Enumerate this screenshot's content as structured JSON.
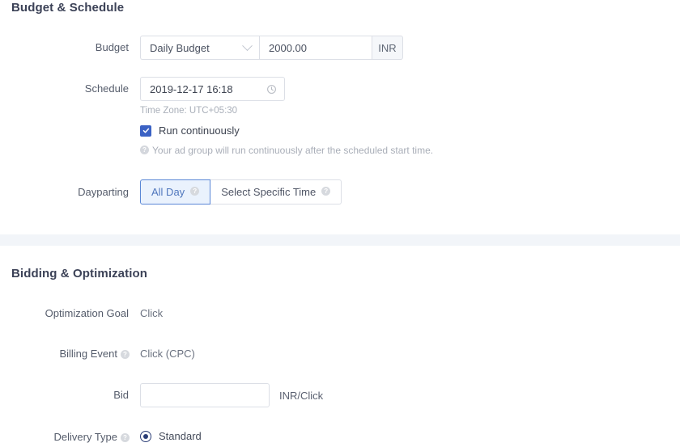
{
  "budget_schedule": {
    "title": "Budget & Schedule",
    "budget": {
      "label": "Budget",
      "type_value": "Daily Budget",
      "amount_value": "2000.00",
      "currency_suffix": "INR",
      "chevron_icon": "chevron-down-icon"
    },
    "schedule": {
      "label": "Schedule",
      "datetime_value": "2019-12-17 16:18",
      "clock_icon": "clock-icon",
      "timezone_text": "Time Zone: UTC+05:30",
      "run_continuously_label": "Run continuously",
      "run_continuously_checked": true,
      "hint_text": "Your ad group will run continuously after the scheduled start time.",
      "hint_icon": "help-circle-icon"
    },
    "dayparting": {
      "label": "Dayparting",
      "options": [
        {
          "label": "All Day",
          "selected": true,
          "help_icon": "help-circle-icon"
        },
        {
          "label": "Select Specific Time",
          "selected": false,
          "help_icon": "help-circle-icon"
        }
      ]
    }
  },
  "bidding_optimization": {
    "title": "Bidding & Optimization",
    "optimization_goal": {
      "label": "Optimization Goal",
      "value": "Click"
    },
    "billing_event": {
      "label": "Billing Event",
      "help_icon": "help-circle-icon",
      "value": "Click (CPC)"
    },
    "bid": {
      "label": "Bid",
      "value": "",
      "placeholder": "",
      "unit": "INR/Click"
    },
    "delivery_type": {
      "label": "Delivery Type",
      "help_icon": "help-circle-icon",
      "options": [
        {
          "label": "Standard",
          "selected": true
        }
      ]
    }
  },
  "colors": {
    "accent_blue": "#3b62c4",
    "segment_active_border": "#5a87d6",
    "segment_active_bg": "#eaf2fd",
    "radio_navy": "#2c3e77",
    "heading": "#3c4257",
    "divider_band": "#f2f5f9"
  }
}
